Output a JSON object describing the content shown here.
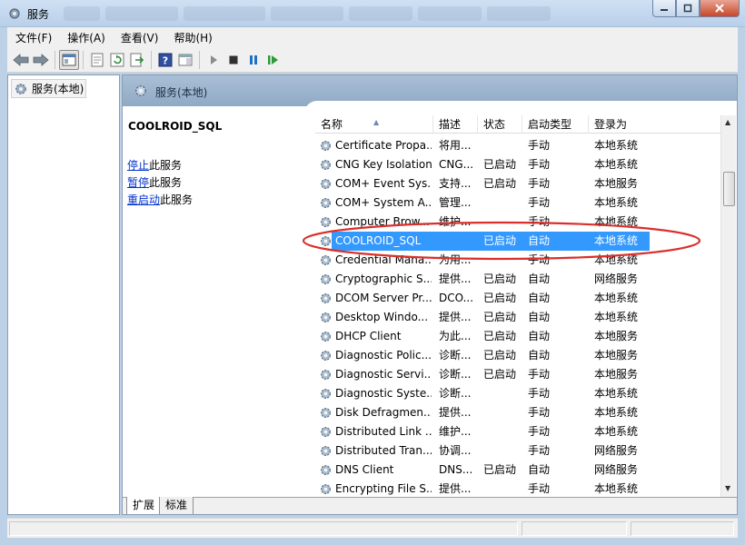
{
  "window": {
    "title": "服务"
  },
  "menu": [
    "文件(F)",
    "操作(A)",
    "查看(V)",
    "帮助(H)"
  ],
  "tree": {
    "root": "服务(本地)"
  },
  "pane": {
    "header": "服务(本地)"
  },
  "extended": {
    "service_name": "COOLROID_SQL",
    "actions": [
      {
        "link": "停止",
        "rest": "此服务"
      },
      {
        "link": "暂停",
        "rest": "此服务"
      },
      {
        "link": "重启动",
        "rest": "此服务"
      }
    ]
  },
  "columns": [
    "名称",
    "描述",
    "状态",
    "启动类型",
    "登录为"
  ],
  "services": [
    {
      "name": "Certificate Propa...",
      "desc": "将用...",
      "status": "",
      "startup": "手动",
      "logon": "本地系统"
    },
    {
      "name": "CNG Key Isolation",
      "desc": "CNG...",
      "status": "已启动",
      "startup": "手动",
      "logon": "本地系统"
    },
    {
      "name": "COM+ Event Sys...",
      "desc": "支持...",
      "status": "已启动",
      "startup": "手动",
      "logon": "本地服务"
    },
    {
      "name": "COM+ System A...",
      "desc": "管理...",
      "status": "",
      "startup": "手动",
      "logon": "本地系统"
    },
    {
      "name": "Computer Brow...",
      "desc": "维护...",
      "status": "",
      "startup": "手动",
      "logon": "本地系统"
    },
    {
      "name": "COOLROID_SQL",
      "desc": "",
      "status": "已启动",
      "startup": "自动",
      "logon": "本地系统",
      "selected": true
    },
    {
      "name": "Credential Mana...",
      "desc": "为用...",
      "status": "",
      "startup": "手动",
      "logon": "本地系统"
    },
    {
      "name": "Cryptographic S...",
      "desc": "提供...",
      "status": "已启动",
      "startup": "自动",
      "logon": "网络服务"
    },
    {
      "name": "DCOM Server Pr...",
      "desc": "DCO...",
      "status": "已启动",
      "startup": "自动",
      "logon": "本地系统"
    },
    {
      "name": "Desktop Windo...",
      "desc": "提供...",
      "status": "已启动",
      "startup": "自动",
      "logon": "本地系统"
    },
    {
      "name": "DHCP Client",
      "desc": "为此...",
      "status": "已启动",
      "startup": "自动",
      "logon": "本地服务"
    },
    {
      "name": "Diagnostic Polic...",
      "desc": "诊断...",
      "status": "已启动",
      "startup": "自动",
      "logon": "本地服务"
    },
    {
      "name": "Diagnostic Servi...",
      "desc": "诊断...",
      "status": "已启动",
      "startup": "手动",
      "logon": "本地服务"
    },
    {
      "name": "Diagnostic Syste...",
      "desc": "诊断...",
      "status": "",
      "startup": "手动",
      "logon": "本地系统"
    },
    {
      "name": "Disk Defragmen...",
      "desc": "提供...",
      "status": "",
      "startup": "手动",
      "logon": "本地系统"
    },
    {
      "name": "Distributed Link ...",
      "desc": "维护...",
      "status": "",
      "startup": "手动",
      "logon": "本地系统"
    },
    {
      "name": "Distributed Tran...",
      "desc": "协调...",
      "status": "",
      "startup": "手动",
      "logon": "网络服务"
    },
    {
      "name": "DNS Client",
      "desc": "DNS...",
      "status": "已启动",
      "startup": "自动",
      "logon": "网络服务"
    },
    {
      "name": "Encrypting File S...",
      "desc": "提供...",
      "status": "",
      "startup": "手动",
      "logon": "本地系统"
    }
  ],
  "tabs": [
    "扩展",
    "标准"
  ],
  "icons": {
    "back": "back-arrow-icon",
    "forward": "forward-arrow-icon",
    "console": "console-tree-icon",
    "export": "export-list-icon",
    "refresh": "refresh-icon",
    "properties": "properties-icon",
    "help": "help-icon",
    "view": "view-icon",
    "start": "play-icon",
    "stop": "stop-icon",
    "pause": "pause-icon",
    "restart": "restart-icon",
    "service": "gear-icon"
  },
  "colors": {
    "selection": "#3399ff",
    "link": "#0033cc",
    "annotation": "#d9302c"
  }
}
